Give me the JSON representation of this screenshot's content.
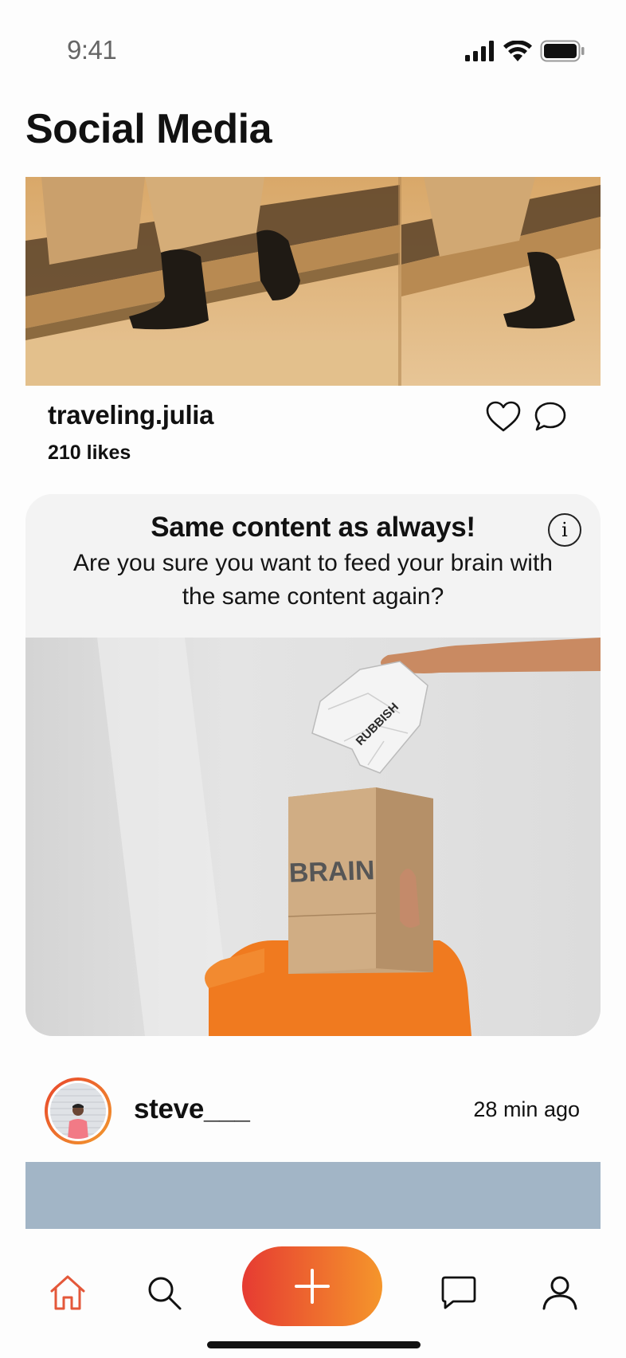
{
  "status_bar": {
    "time": "9:41",
    "icons": [
      "signal-icon",
      "wifi-icon",
      "battery-icon"
    ]
  },
  "page": {
    "title": "Social Media"
  },
  "post1": {
    "username": "traveling.julia",
    "likes": "210 likes",
    "actions": [
      "heart-icon",
      "comment-icon"
    ]
  },
  "warning": {
    "title": "Same content as always!",
    "message": "Are you sure you want to feed your brain with the same content again?",
    "info_icon": "i",
    "image_labels": {
      "paper": "RUBBISH",
      "box": "BRAIN"
    }
  },
  "post2": {
    "username": "steve___",
    "time": "28 min ago"
  },
  "nav": {
    "items": [
      "home-icon",
      "search-icon",
      "add-icon",
      "messages-icon",
      "profile-icon"
    ],
    "active": "home-icon"
  },
  "colors": {
    "accent_start": "#e63b32",
    "accent_end": "#f5962b",
    "home_active": "#e4583a",
    "post2_image": "#a2b5c6"
  }
}
